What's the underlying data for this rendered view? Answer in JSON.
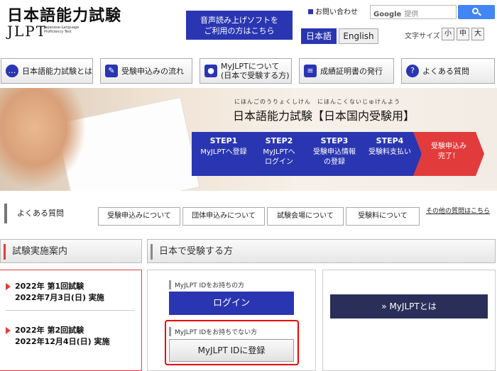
{
  "header": {
    "logo_jp": "日本語能力試験",
    "logo_en": "JLPT",
    "logo_sub": "Japanese-Language Proficiency Test",
    "tts_line1": "音声読み上げソフトを",
    "tts_line2": "ご利用の方はこちら",
    "contact": "お問い合わせ",
    "search_brand": "Google",
    "search_placeholder": "提供",
    "lang_jp": "日本語",
    "lang_en": "English",
    "fontsize_label": "文字サイズ",
    "fontsize_small": "小",
    "fontsize_medium": "中",
    "fontsize_large": "大"
  },
  "nav": [
    {
      "label": "日本語能力試験とは",
      "icon": "chat-icon"
    },
    {
      "label": "受験申込みの流れ",
      "icon": "pencil-icon"
    },
    {
      "label1": "MyJLPTについて",
      "label2": "(日本で受験する方)",
      "icon": "person-icon"
    },
    {
      "label": "成績証明書の発行",
      "icon": "document-icon"
    },
    {
      "label": "よくある質問",
      "icon": "question-icon"
    }
  ],
  "banner": {
    "ruby": "にほんごのうりょくしけん　にほんこくないじゅけんよう",
    "title": "日本語能力試験【日本国内受験用】",
    "steps": [
      {
        "step": "STEP1",
        "line1": "MyJLPTへ登録",
        "line2": ""
      },
      {
        "step": "STEP2",
        "line1": "MyJLPTへ",
        "line2": "ログイン"
      },
      {
        "step": "STEP3",
        "line1": "受験申込情報",
        "line2": "の登録"
      },
      {
        "step": "STEP4",
        "line1": "受験料支払い",
        "line2": ""
      },
      {
        "step": "",
        "line1": "受験申込み",
        "line2": "完了！"
      }
    ]
  },
  "faq": {
    "label": "よくある質問",
    "buttons": [
      "受験申込みについて",
      "団体申込みについて",
      "試験会場について",
      "受験料について"
    ],
    "other": "その他の質問はこちら"
  },
  "exam_info": {
    "title": "試験実施案内",
    "items": [
      {
        "line1": "2022年 第1回試験",
        "line2": "2022年7月3日(日) 実施"
      },
      {
        "line1": "2022年 第2回試験",
        "line2": "2022年12月4日(日) 実施"
      }
    ]
  },
  "domestic": {
    "title": "日本で受験する方",
    "has_id_label": "MyJLPT IDをお持ちの方",
    "login_label": "ログイン",
    "no_id_label": "MyJLPT IDをお持ちでない方",
    "register_label": "MyJLPT IDに登録",
    "myjlpt_label": "» MyJLPTとは"
  },
  "colors": {
    "brand_blue": "#2a36b1",
    "accent_red": "#e23b3b"
  }
}
